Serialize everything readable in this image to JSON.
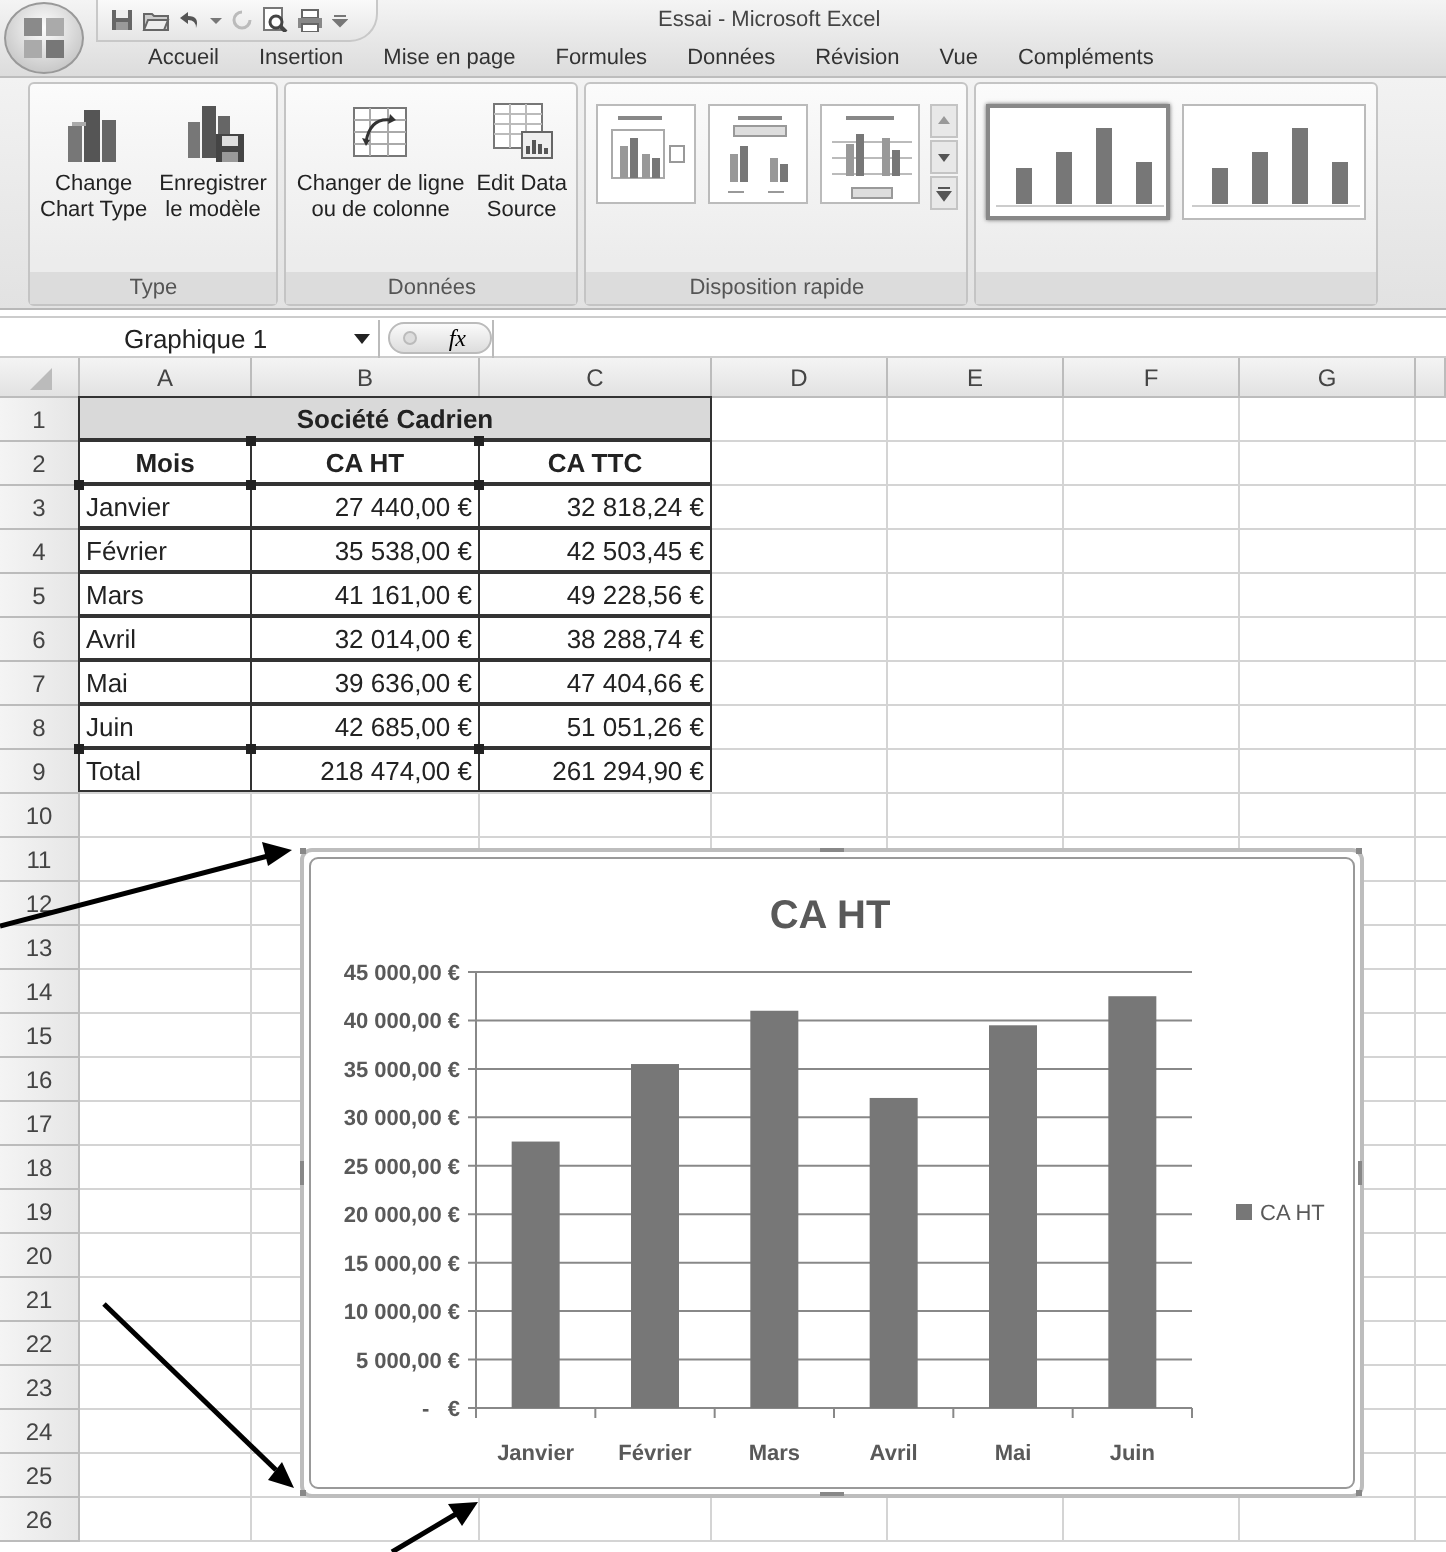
{
  "window": {
    "title": "Essai - Microsoft Excel"
  },
  "tabs": [
    {
      "label": "Accueil",
      "selected": false
    },
    {
      "label": "Insertion",
      "selected": false
    },
    {
      "label": "Mise en page",
      "selected": false
    },
    {
      "label": "Formules",
      "selected": false
    },
    {
      "label": "Données",
      "selected": false
    },
    {
      "label": "Révision",
      "selected": false
    },
    {
      "label": "Vue",
      "selected": false
    },
    {
      "label": "Compléments",
      "selected": false
    }
  ],
  "ribbon": {
    "groups": [
      {
        "kind": "buttons",
        "label": "Type",
        "buttons": [
          "Change\nChart Type",
          "Enregistrer\nle modèle"
        ]
      },
      {
        "kind": "buttons",
        "label": "Données",
        "buttons": [
          "Changer de ligne\nou de colonne",
          "Edit Data\nSource"
        ]
      },
      {
        "kind": "layouts",
        "label": "Disposition rapide",
        "items": [
          {
            "selected": false
          },
          {
            "selected": false
          },
          {
            "selected": false
          }
        ]
      },
      {
        "kind": "styles",
        "items": [
          {
            "selected": true
          },
          {
            "selected": false
          }
        ]
      }
    ]
  },
  "formula_bar": {
    "name_box": "Graphique 1",
    "fx": "fx"
  },
  "sheet": {
    "columns": [
      "A",
      "B",
      "C",
      "D",
      "E",
      "F",
      "G"
    ],
    "rows": [
      "1",
      "2",
      "3",
      "4",
      "5",
      "6",
      "7",
      "8",
      "9",
      "10",
      "11",
      "12",
      "13",
      "14",
      "15",
      "16",
      "17",
      "18",
      "19",
      "20",
      "21",
      "22",
      "23",
      "24",
      "25",
      "26"
    ],
    "table": {
      "title": "Société Cadrien",
      "header": [
        "Mois",
        "CA HT",
        "CA TTC"
      ],
      "rows": [
        [
          "Janvier",
          "27 440,00 €",
          "32 818,24 €"
        ],
        [
          "Février",
          "35 538,00 €",
          "42 503,45 €"
        ],
        [
          "Mars",
          "41 161,00 €",
          "49 228,56 €"
        ],
        [
          "Avril",
          "32 014,00 €",
          "38 288,74 €"
        ],
        [
          "Mai",
          "39 636,00 €",
          "47 404,66 €"
        ],
        [
          "Juin",
          "42 685,00 €",
          "51 051,26 €"
        ],
        [
          "Total",
          "218 474,00 €",
          "261 294,90 €"
        ]
      ]
    }
  },
  "chart": {
    "chart_data": {
      "type": "bar",
      "title": "CA HT",
      "categories": [
        "Janvier",
        "Février",
        "Mars",
        "Avril",
        "Mai",
        "Juin"
      ],
      "series": [
        {
          "name": "CA HT",
          "color": "#777777",
          "values": [
            27500,
            35500,
            41000,
            32000,
            39500,
            42500
          ]
        }
      ],
      "grid": true,
      "ylim": [
        0,
        45000
      ],
      "yticks": [
        {
          "value": 0,
          "label": "-   €"
        },
        {
          "value": 5000,
          "label": "5 000,00 €"
        },
        {
          "value": 10000,
          "label": "10 000,00 €"
        },
        {
          "value": 15000,
          "label": "15 000,00 €"
        },
        {
          "value": 20000,
          "label": "20 000,00 €"
        },
        {
          "value": 25000,
          "label": "25 000,00 €"
        },
        {
          "value": 30000,
          "label": "30 000,00 €"
        },
        {
          "value": 35000,
          "label": "35 000,00 €"
        },
        {
          "value": 40000,
          "label": "40 000,00 €"
        },
        {
          "value": 45000,
          "label": "45 000,00 €"
        }
      ]
    }
  }
}
